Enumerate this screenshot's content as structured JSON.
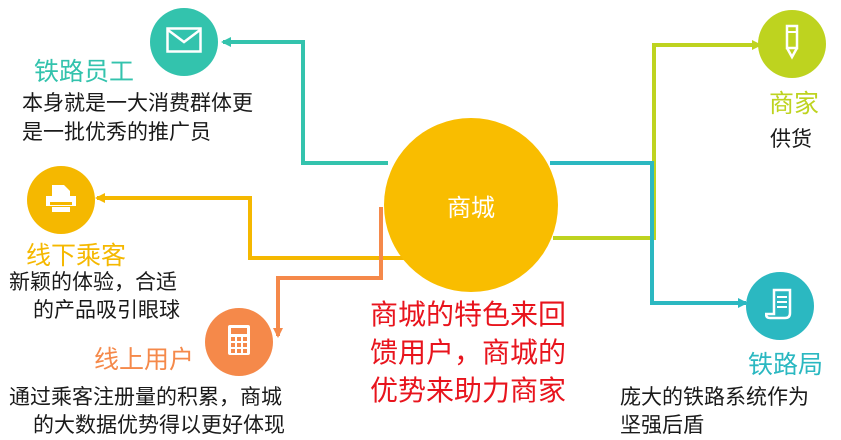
{
  "colors": {
    "center": "#f9bd00",
    "teal": "#33c3ad",
    "amber": "#f5b800",
    "orange": "#f5894a",
    "lime": "#bed31f",
    "cyan": "#2bb8c1",
    "red_text": "#e8141d"
  },
  "center": {
    "label": "商城"
  },
  "nodes": {
    "railway_staff": {
      "title": "铁路员工",
      "desc": [
        "本身就是一大消费群体更",
        "是一批优秀的推广员"
      ],
      "icon": "envelope-icon"
    },
    "offline_passenger": {
      "title": "线下乘客",
      "desc": [
        "新颖的体验，合适",
        "的产品吸引眼球"
      ],
      "icon": "printer-icon"
    },
    "online_user": {
      "title": "线上用户",
      "desc": [
        "通过乘客注册量的积累，商城",
        "的大数据优势得以更好体现"
      ],
      "icon": "calculator-icon"
    },
    "merchant": {
      "title": "商家",
      "desc": [
        "供货"
      ],
      "icon": "pen-icon"
    },
    "railway_bureau": {
      "title": "铁路局",
      "desc": [
        "庞大的铁路系统作为",
        "坚强后盾"
      ],
      "icon": "scroll-icon"
    }
  },
  "highlight": [
    "商城的特色来回",
    "馈用户，商城的",
    "优势来助力商家"
  ]
}
